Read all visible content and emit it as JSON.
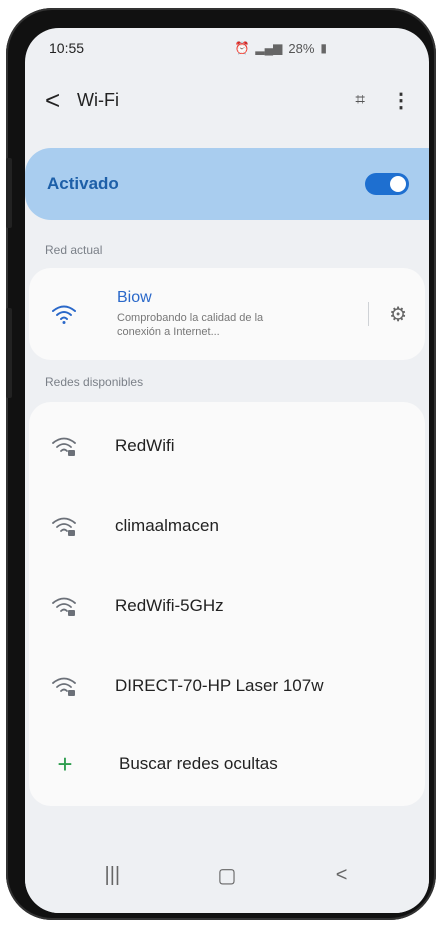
{
  "status_bar": {
    "time": "10:55",
    "battery": "28%"
  },
  "app_bar": {
    "title": "Wi-Fi",
    "back_glyph": "<",
    "qr_glyph": "⌗",
    "more_glyph": "⋮"
  },
  "master_switch": {
    "label": "Activado",
    "on": true,
    "color": "#1e6fd0"
  },
  "current_network": {
    "section_label": "Red actual",
    "name": "Biow",
    "status": "Comprobando la calidad de la conexión a Internet...",
    "icon": "wifi-icon",
    "settings_icon": "gear-icon",
    "name_color": "#2a68c9"
  },
  "available_networks": {
    "section_label": "Redes disponibles",
    "items": [
      {
        "name": "RedWifi",
        "icon": "wifi-lock-icon"
      },
      {
        "name": "climaalmacen",
        "icon": "wifi-lock-icon"
      },
      {
        "name": "RedWifi-5GHz",
        "icon": "wifi-lock-icon"
      },
      {
        "name": "DIRECT-70-HP Laser 107w",
        "icon": "wifi-lock-icon"
      }
    ],
    "add_hidden_label": "Buscar redes ocultas",
    "add_icon": "plus-icon"
  },
  "nav_bar": {
    "recents_glyph": "|||",
    "home_glyph": "▢",
    "back_glyph": "<"
  }
}
